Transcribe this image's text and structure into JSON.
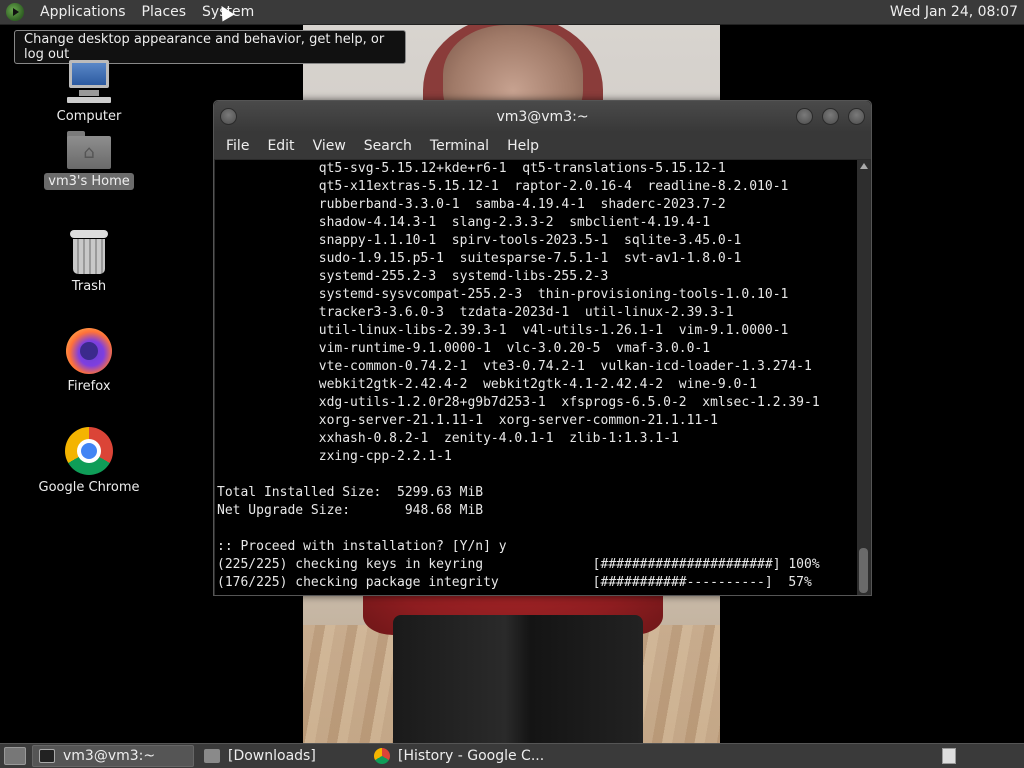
{
  "top_panel": {
    "menus": [
      "Applications",
      "Places",
      "System"
    ],
    "clock": "Wed Jan 24, 08:07"
  },
  "tooltip": "Change desktop appearance and behavior, get help, or log out",
  "desktop_icons": [
    {
      "label": "Computer",
      "icon": "computer-icon"
    },
    {
      "label": "vm3's Home",
      "icon": "home-folder-icon"
    },
    {
      "label": "Trash",
      "icon": "trash-icon"
    },
    {
      "label": "Firefox",
      "icon": "firefox-icon"
    },
    {
      "label": "Google Chrome",
      "icon": "chrome-icon"
    }
  ],
  "terminal": {
    "title": "vm3@vm3:~",
    "menu": [
      "File",
      "Edit",
      "View",
      "Search",
      "Terminal",
      "Help"
    ],
    "lines": [
      "             qt5-svg-5.15.12+kde+r6-1  qt5-translations-5.15.12-1",
      "             qt5-x11extras-5.15.12-1  raptor-2.0.16-4  readline-8.2.010-1",
      "             rubberband-3.3.0-1  samba-4.19.4-1  shaderc-2023.7-2",
      "             shadow-4.14.3-1  slang-2.3.3-2  smbclient-4.19.4-1",
      "             snappy-1.1.10-1  spirv-tools-2023.5-1  sqlite-3.45.0-1",
      "             sudo-1.9.15.p5-1  suitesparse-7.5.1-1  svt-av1-1.8.0-1",
      "             systemd-255.2-3  systemd-libs-255.2-3",
      "             systemd-sysvcompat-255.2-3  thin-provisioning-tools-1.0.10-1",
      "             tracker3-3.6.0-3  tzdata-2023d-1  util-linux-2.39.3-1",
      "             util-linux-libs-2.39.3-1  v4l-utils-1.26.1-1  vim-9.1.0000-1",
      "             vim-runtime-9.1.0000-1  vlc-3.0.20-5  vmaf-3.0.0-1",
      "             vte-common-0.74.2-1  vte3-0.74.2-1  vulkan-icd-loader-1.3.274-1",
      "             webkit2gtk-2.42.4-2  webkit2gtk-4.1-2.42.4-2  wine-9.0-1",
      "             xdg-utils-1.2.0r28+g9b7d253-1  xfsprogs-6.5.0-2  xmlsec-1.2.39-1",
      "             xorg-server-21.1.11-1  xorg-server-common-21.1.11-1",
      "             xxhash-0.8.2-1  zenity-4.0.1-1  zlib-1:1.3.1-1",
      "             zxing-cpp-2.2.1-1",
      "",
      "Total Installed Size:  5299.63 MiB",
      "Net Upgrade Size:       948.68 MiB",
      "",
      ":: Proceed with installation? [Y/n] y",
      "(225/225) checking keys in keyring              [######################] 100%",
      "(176/225) checking package integrity            [###########----------]  57%"
    ]
  },
  "taskbar": [
    {
      "label": "vm3@vm3:~",
      "icon": "terminal-icon",
      "active": true
    },
    {
      "label": "[Downloads]",
      "icon": "folder-icon",
      "active": false
    },
    {
      "label": "[History - Google C...",
      "icon": "chrome-icon",
      "active": false
    }
  ]
}
